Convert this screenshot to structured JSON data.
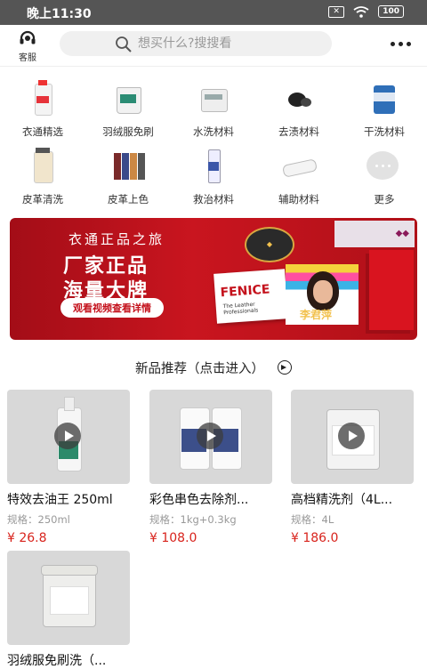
{
  "status_bar": {
    "time": "晚上11:30",
    "battery": "100"
  },
  "header": {
    "service_label": "客服",
    "search_placeholder": "想买什么?搜搜看"
  },
  "categories": [
    {
      "label": "衣通精选",
      "icon": "bottle-icon"
    },
    {
      "label": "羽绒服免刷",
      "icon": "bucket-icon"
    },
    {
      "label": "水洗材料",
      "icon": "tub-icon"
    },
    {
      "label": "去渍材料",
      "icon": "powder-icon"
    },
    {
      "label": "干洗材料",
      "icon": "drum-icon"
    },
    {
      "label": "皮革清洗",
      "icon": "jar-icon"
    },
    {
      "label": "皮革上色",
      "icon": "bottles-icon"
    },
    {
      "label": "救治材料",
      "icon": "spray-bottle-icon"
    },
    {
      "label": "辅助材料",
      "icon": "roll-icon"
    },
    {
      "label": "更多",
      "icon": "more-dots-icon"
    }
  ],
  "banner": {
    "subtitle": "衣通正品之旅",
    "headline_1": "厂家正品",
    "headline_2": "海量大牌",
    "cta": "观看视频查看详情",
    "brand_logo_text": "FENICE",
    "brand_logo_sub": "The Leather Professionals",
    "person_name": "李君萍"
  },
  "section": {
    "title": "新品推荐（点击进入）"
  },
  "products": [
    {
      "name": "特效去油王 250ml",
      "spec": "规格：250ml",
      "price": "¥ 26.8"
    },
    {
      "name": "彩色串色去除剂...",
      "spec": "规格：1kg+0.3kg",
      "price": "¥ 108.0"
    },
    {
      "name": "高档精洗剂（4L...",
      "spec": "规格：4L",
      "price": "¥ 186.0"
    },
    {
      "name": "羽绒服免刷洗（...",
      "spec": "",
      "price": ""
    }
  ],
  "colors": {
    "accent": "#d8231c",
    "banner": "#c9151f",
    "statusbar": "#555555"
  }
}
